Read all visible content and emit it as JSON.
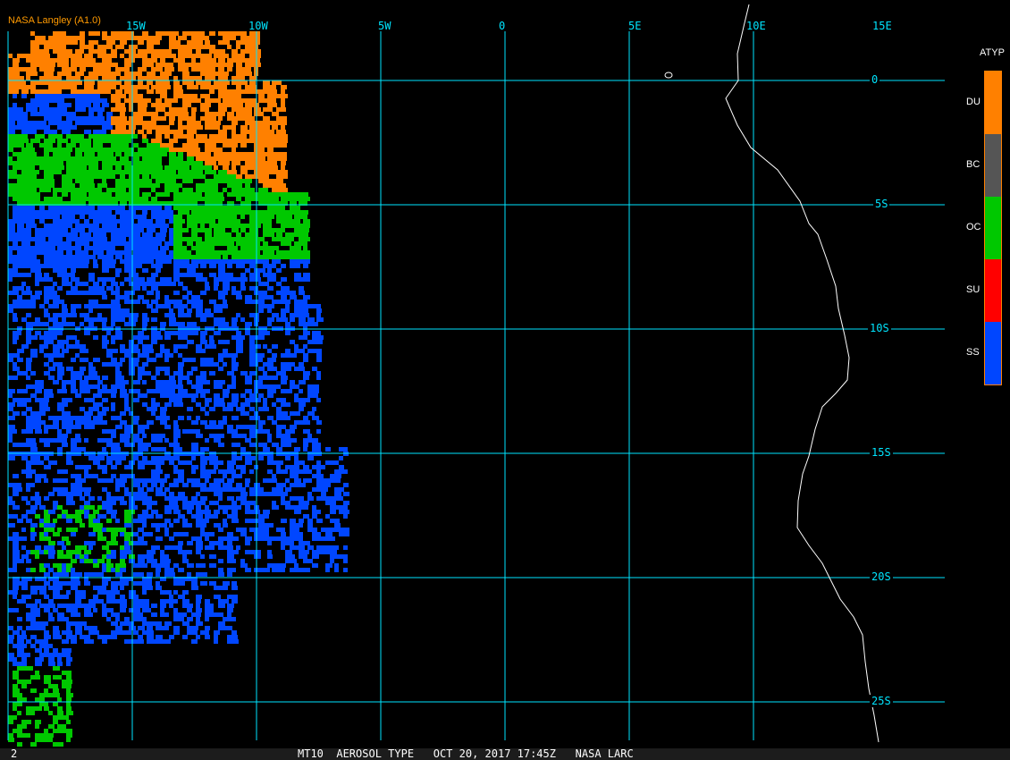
{
  "source_label": "NASA Langley (A1.0)",
  "longitude_labels": [
    "15W",
    "10W",
    "5W",
    "0",
    "5E",
    "10E",
    "15E"
  ],
  "latitude_labels": [
    "0",
    "5S",
    "10S",
    "15S",
    "20S",
    "25S"
  ],
  "legend": {
    "title": "ATYP",
    "items": [
      {
        "label": "DU",
        "color": "#ff8000"
      },
      {
        "label": "BC",
        "color": "#555555"
      },
      {
        "label": "OC",
        "color": "#00c800"
      },
      {
        "label": "SU",
        "color": "#ff0000"
      },
      {
        "label": "SS",
        "color": "#0046ff"
      }
    ]
  },
  "status_bar": {
    "frame": "2",
    "caption": "MT10  AEROSOL TYPE   OCT 20, 2017 17:45Z   NASA LARC"
  },
  "colors": {
    "grid": "#00e5ff",
    "coast": "#ffffff"
  }
}
